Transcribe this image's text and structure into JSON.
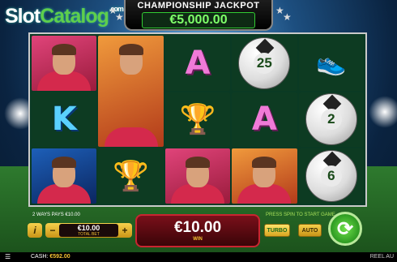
{
  "logo": {
    "slot": "Slot",
    "catalog": "Catalog",
    "com": ".com"
  },
  "jackpot": {
    "title": "CHAMPIONSHIP JACKPOT",
    "value": "€5,000.00"
  },
  "reels": [
    [
      {
        "kind": "player"
      },
      {
        "kind": "letter",
        "text": "K"
      },
      {
        "kind": "player"
      }
    ],
    [
      {
        "kind": "player"
      },
      {
        "kind": "trophy"
      }
    ],
    [
      {
        "kind": "letter",
        "text": "A"
      },
      {
        "kind": "trophy"
      },
      {
        "kind": "player"
      }
    ],
    [
      {
        "kind": "ball",
        "num": "25"
      },
      {
        "kind": "letter",
        "text": "A"
      },
      {
        "kind": "player"
      }
    ],
    [
      {
        "kind": "boot"
      },
      {
        "kind": "ball",
        "num": "2"
      },
      {
        "kind": "ball",
        "num": "6"
      }
    ]
  ],
  "footer": {
    "ways": "2 WAYS PAYS €10.00",
    "spin_msg": "PRESS SPIN TO START GAME",
    "info": "i",
    "minus": "−",
    "plus": "+",
    "bet_value": "€10.00",
    "bet_label": "TOTAL BET",
    "win_value": "€10.00",
    "win_label": "WIN",
    "turbo": "TURBO",
    "auto": "AUTO"
  },
  "status": {
    "cash_label": "CASH:",
    "cash_value": "€592.00",
    "reel_label": "REEL AU"
  },
  "colors": {
    "accent": "#f5c233",
    "spin": "#2d9a22",
    "win_border": "#c92530"
  }
}
